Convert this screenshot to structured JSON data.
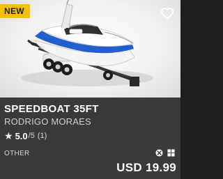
{
  "badge": {
    "label": "NEW"
  },
  "thumbnail": {
    "alt": "speedboat-on-trailer-render"
  },
  "favorite": {
    "icon": "heart-outline-icon"
  },
  "product": {
    "title": "SPEEDBOAT 35FT",
    "author": "RODRIGO MORAES",
    "rating": {
      "star": "★",
      "average": "5.0",
      "max": "/5",
      "count": "(1)",
      "value": 5.0
    },
    "category": "OTHER",
    "platforms": [
      "xbox-icon",
      "windows-icon"
    ],
    "price": "USD 19.99"
  },
  "colors": {
    "badge": "#f2c300",
    "card": "#3a3a3a",
    "hull_accent": "#1f5fd1",
    "text": "#ffffff"
  }
}
